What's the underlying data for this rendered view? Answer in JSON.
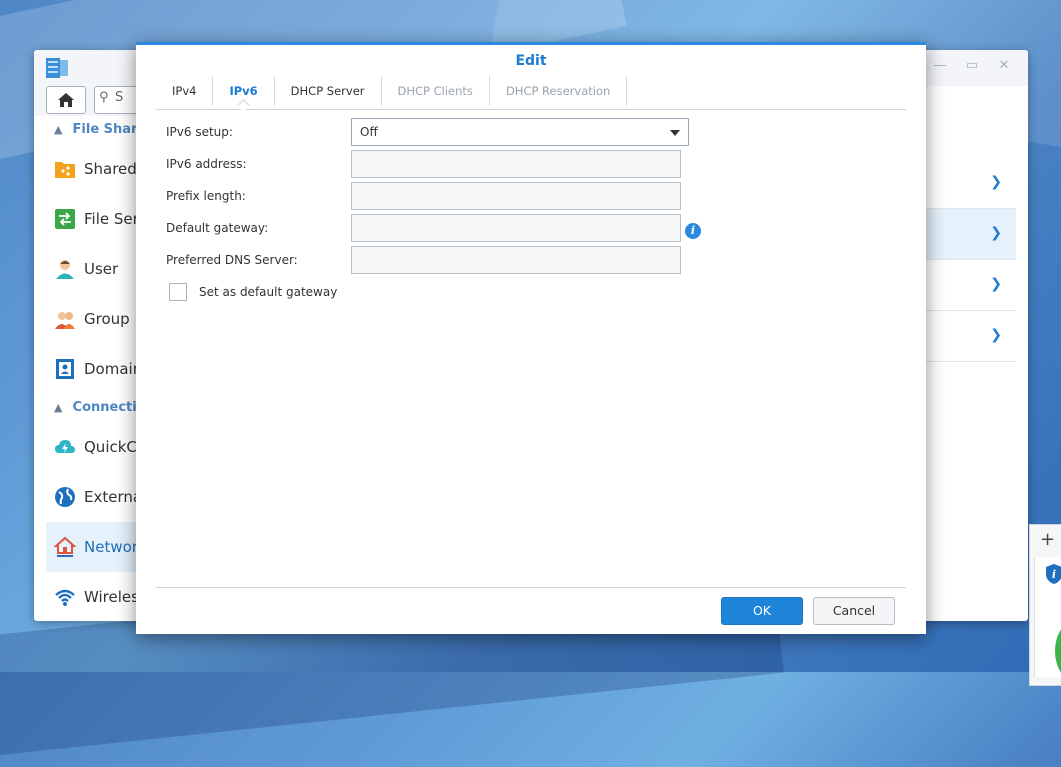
{
  "dialog": {
    "title": "Edit",
    "tabs": [
      {
        "label": "IPv4",
        "state": "normal"
      },
      {
        "label": "IPv6",
        "state": "active"
      },
      {
        "label": "DHCP Server",
        "state": "normal"
      },
      {
        "label": "DHCP Clients",
        "state": "disabled"
      },
      {
        "label": "DHCP Reservation",
        "state": "disabled"
      }
    ],
    "fields": {
      "setup_label": "IPv6 setup:",
      "setup_value": "Off",
      "address_label": "IPv6 address:",
      "prefix_label": "Prefix length:",
      "gateway_label": "Default gateway:",
      "dns_label": "Preferred DNS Server:"
    },
    "checkbox_label": "Set as default gateway",
    "ok_label": "OK",
    "cancel_label": "Cancel"
  },
  "sidebar": {
    "search_placeholder": "S",
    "sections": [
      {
        "label": "File Shar"
      },
      {
        "label": "Connectiv"
      }
    ],
    "items": [
      {
        "label": "Shared"
      },
      {
        "label": "File Ser"
      },
      {
        "label": "User"
      },
      {
        "label": "Group"
      },
      {
        "label": "Domain"
      },
      {
        "label": "QuickCo"
      },
      {
        "label": "Externa"
      },
      {
        "label": "Networl"
      },
      {
        "label": "Wireles"
      }
    ]
  },
  "colors": {
    "accent": "#1a7cd1",
    "ok_button": "#1f85d9",
    "sidebar_active_bg": "#e5f1fb"
  }
}
